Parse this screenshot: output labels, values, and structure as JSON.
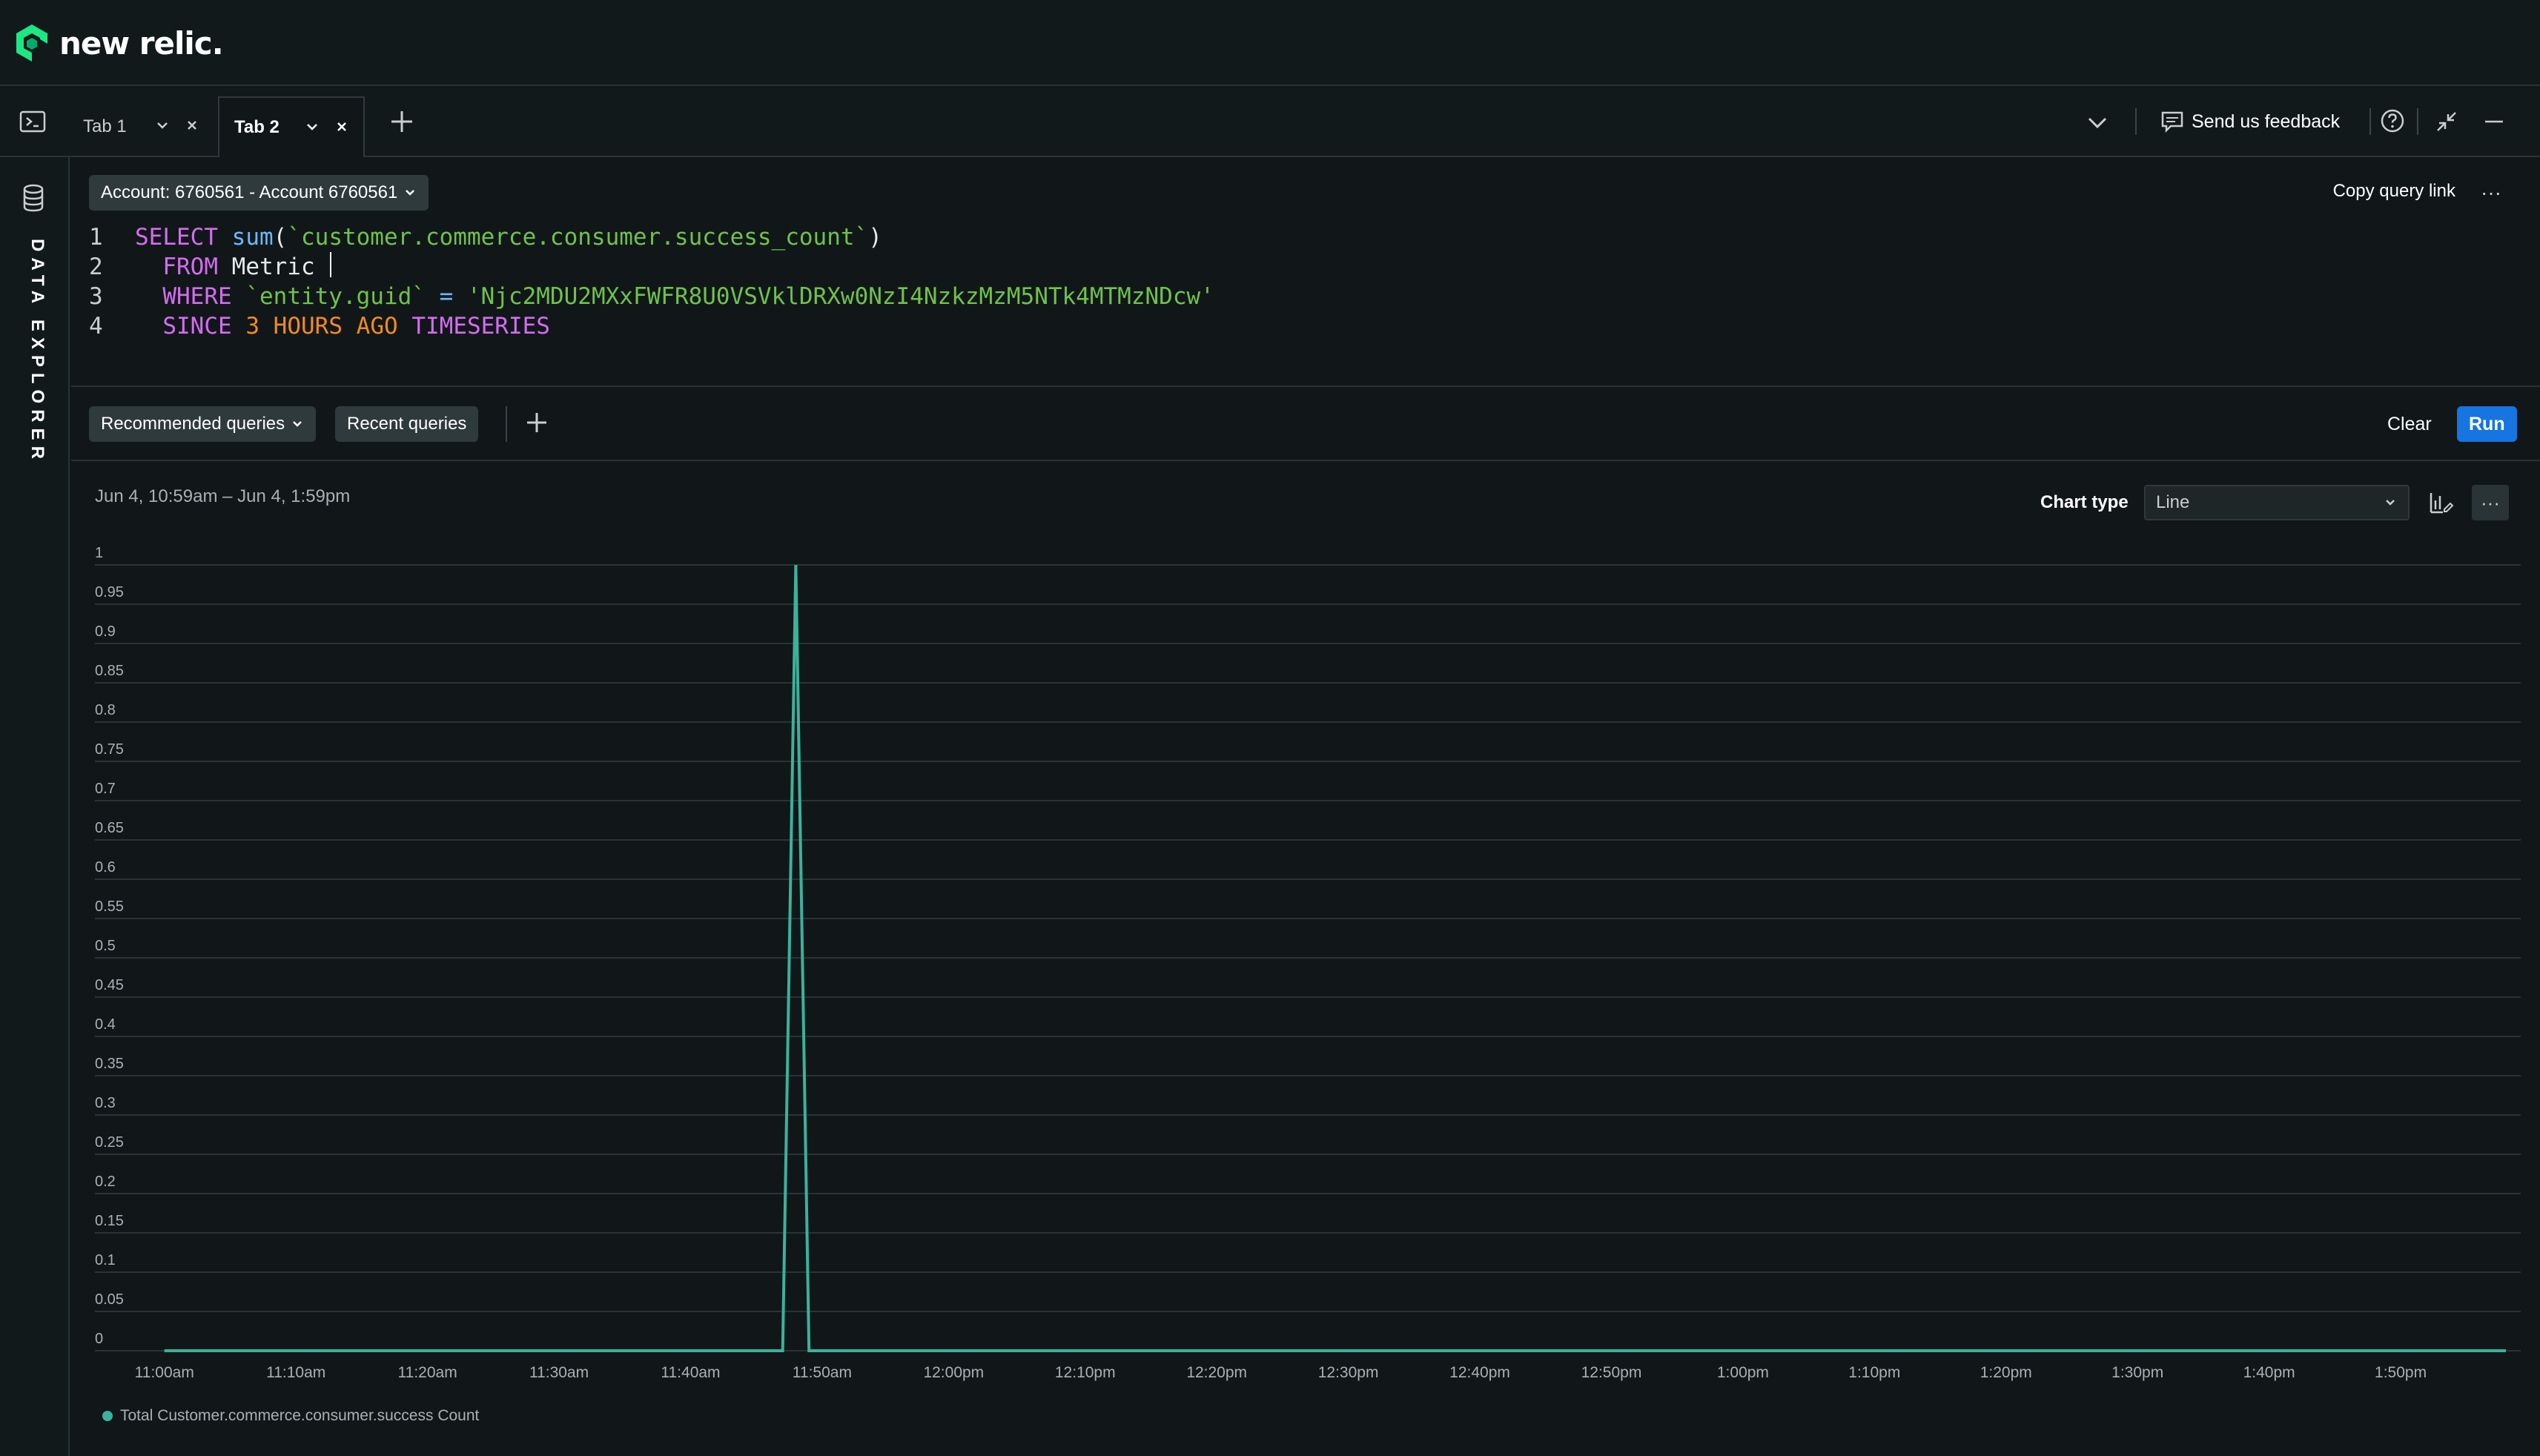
{
  "brand": {
    "logo_text": "new relic."
  },
  "tabs": [
    {
      "label": "Tab 1",
      "active": false
    },
    {
      "label": "Tab 2",
      "active": true
    }
  ],
  "toolbar": {
    "feedback_label": "Send us feedback"
  },
  "rail": {
    "vertical_label": "DATA EXPLORER"
  },
  "query": {
    "account_label": "Account: 6760561 - Account 6760561",
    "copy_link_label": "Copy query link",
    "more_label": "···",
    "line_numbers": [
      "1",
      "2",
      "3",
      "4"
    ],
    "line1": {
      "kw": "SELECT",
      "fn": "sum",
      "open": "(",
      "str": "`customer.commerce.consumer.success_count`",
      "close": ")"
    },
    "line2": {
      "kw": "FROM",
      "plain": "Metric"
    },
    "line3": {
      "kw": "WHERE",
      "str1": "`entity.guid`",
      "op": "=",
      "str2": "'Njc2MDU2MXxFWFR8U0VSVklDRXw0NzI4NzkzMzM5NTk4MTMzNDcw'"
    },
    "line4": {
      "kw1": "SINCE",
      "num": "3",
      "kw2": "HOURS AGO",
      "kw3": "TIMESERIES"
    }
  },
  "query_bar": {
    "recommended_label": "Recommended queries",
    "recent_label": "Recent queries",
    "clear_label": "Clear",
    "run_label": "Run"
  },
  "chart_panel": {
    "date_range": "Jun 4, 10:59am – Jun 4, 1:59pm",
    "chart_type_label": "Chart type",
    "chart_type_value": "Line",
    "more_label": "···"
  },
  "colors": {
    "series": "#3bb29b",
    "run": "#1675e0",
    "grid": "#2a3336"
  },
  "chart_data": {
    "type": "line",
    "title": "",
    "xlabel": "",
    "ylabel": "",
    "ylim": [
      0,
      1
    ],
    "yticks": [
      "0",
      "0.05",
      "0.1",
      "0.15",
      "0.2",
      "0.25",
      "0.3",
      "0.35",
      "0.4",
      "0.45",
      "0.5",
      "0.55",
      "0.6",
      "0.65",
      "0.7",
      "0.75",
      "0.8",
      "0.85",
      "0.9",
      "0.95",
      "1"
    ],
    "xlim": [
      "10:59am",
      "1:58pm"
    ],
    "xticks": [
      "11:00am",
      "11:10am",
      "11:20am",
      "11:30am",
      "11:40am",
      "11:50am",
      "12:00pm",
      "12:10pm",
      "12:20pm",
      "12:30pm",
      "12:40pm",
      "12:50pm",
      "1:00pm",
      "1:10pm",
      "1:20pm",
      "1:30pm",
      "1:40pm",
      "1:50pm"
    ],
    "grid": true,
    "legend": "bottom-left",
    "series": [
      {
        "name": "Total Customer.commerce.consumer.success Count",
        "points": [
          {
            "x": "11:00am",
            "y": 0
          },
          {
            "x": "11:47am",
            "y": 0
          },
          {
            "x": "11:48am",
            "y": 1
          },
          {
            "x": "11:49am",
            "y": 0
          },
          {
            "x": "1:58pm",
            "y": 0
          }
        ]
      }
    ]
  }
}
